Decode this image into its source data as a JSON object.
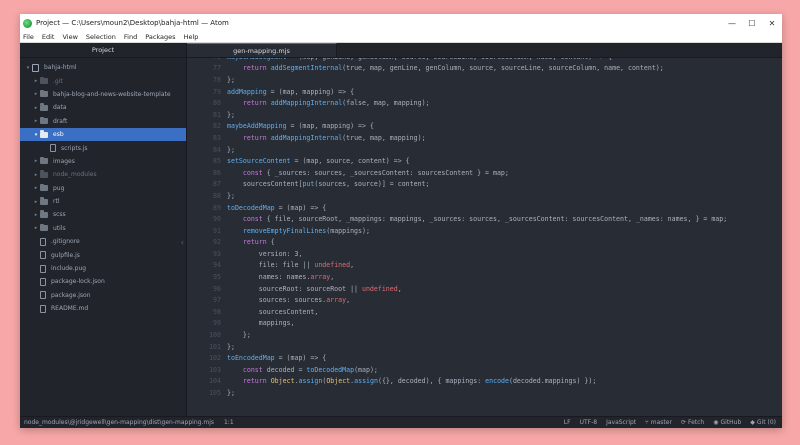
{
  "window": {
    "title": "Project — C:\\Users\\moun2\\Desktop\\bahja-html — Atom",
    "controls": {
      "minimize": "—",
      "maximize": "☐",
      "close": "✕"
    }
  },
  "menu": [
    "File",
    "Edit",
    "View",
    "Selection",
    "Find",
    "Packages",
    "Help"
  ],
  "sidebar": {
    "header": "Project",
    "items": [
      {
        "label": "bahja-html",
        "kind": "root",
        "expanded": true
      },
      {
        "label": ".git",
        "kind": "folder",
        "dim": true
      },
      {
        "label": "bahja-blog-and-news-website-template",
        "kind": "folder"
      },
      {
        "label": "data",
        "kind": "folder"
      },
      {
        "label": "draft",
        "kind": "folder"
      },
      {
        "label": "esb",
        "kind": "folder",
        "expanded": true,
        "selected": true
      },
      {
        "label": "scripts.js",
        "kind": "file",
        "indent": 2
      },
      {
        "label": "images",
        "kind": "folder"
      },
      {
        "label": "node_modules",
        "kind": "folder",
        "dim": true
      },
      {
        "label": "pug",
        "kind": "folder"
      },
      {
        "label": "rtl",
        "kind": "folder"
      },
      {
        "label": "scss",
        "kind": "folder"
      },
      {
        "label": "utils",
        "kind": "folder"
      },
      {
        "label": ".gitignore",
        "kind": "file"
      },
      {
        "label": "gulpfile.js",
        "kind": "file"
      },
      {
        "label": "include.pug",
        "kind": "file"
      },
      {
        "label": "package-lock.json",
        "kind": "file"
      },
      {
        "label": "package.json",
        "kind": "file"
      },
      {
        "label": "README.md",
        "kind": "file"
      }
    ]
  },
  "editor": {
    "tab": "gen-mapping.mjs",
    "lines": [
      {
        "n": "76",
        "code": "maybeAddSegment = (map, genLine, genColumn, source, sourceLine, sourceColumn, name, content) => {"
      },
      {
        "n": "77",
        "code": "    return addSegmentInternal(true, map, genLine, genColumn, source, sourceLine, sourceColumn, name, content);"
      },
      {
        "n": "78",
        "code": "};"
      },
      {
        "n": "79",
        "code": "addMapping = (map, mapping) => {"
      },
      {
        "n": "80",
        "code": "    return addMappingInternal(false, map, mapping);"
      },
      {
        "n": "81",
        "code": "};"
      },
      {
        "n": "82",
        "code": "maybeAddMapping = (map, mapping) => {"
      },
      {
        "n": "83",
        "code": "    return addMappingInternal(true, map, mapping);"
      },
      {
        "n": "84",
        "code": "};"
      },
      {
        "n": "85",
        "code": "setSourceContent = (map, source, content) => {"
      },
      {
        "n": "86",
        "code": "    const { _sources: sources, _sourcesContent: sourcesContent } = map;"
      },
      {
        "n": "87",
        "code": "    sourcesContent[put(sources, source)] = content;"
      },
      {
        "n": "88",
        "code": "};"
      },
      {
        "n": "89",
        "code": "toDecodedMap = (map) => {"
      },
      {
        "n": "90",
        "code": "    const { file, sourceRoot, _mappings: mappings, _sources: sources, _sourcesContent: sourcesContent, _names: names, } = map;"
      },
      {
        "n": "91",
        "code": "    removeEmptyFinalLines(mappings);"
      },
      {
        "n": "92",
        "code": "    return {"
      },
      {
        "n": "93",
        "code": "        version: 3,"
      },
      {
        "n": "94",
        "code": "        file: file || undefined,"
      },
      {
        "n": "95",
        "code": "        names: names.array,"
      },
      {
        "n": "96",
        "code": "        sourceRoot: sourceRoot || undefined,"
      },
      {
        "n": "97",
        "code": "        sources: sources.array,"
      },
      {
        "n": "98",
        "code": "        sourcesContent,"
      },
      {
        "n": "99",
        "code": "        mappings,"
      },
      {
        "n": "100",
        "code": "    };"
      },
      {
        "n": "101",
        "code": "};"
      },
      {
        "n": "102",
        "code": "toEncodedMap = (map) => {"
      },
      {
        "n": "103",
        "code": "    const decoded = toDecodedMap(map);"
      },
      {
        "n": "104",
        "code": "    return Object.assign(Object.assign({}, decoded), { mappings: encode(decoded.mappings) });"
      },
      {
        "n": "105",
        "code": "};"
      }
    ]
  },
  "statusbar": {
    "path": "node_modules\\@jridgewell\\gen-mapping\\dist\\gen-mapping.mjs",
    "cursor": "1:1",
    "line_ending": "LF",
    "encoding": "UTF-8",
    "grammar": "JavaScript",
    "branch": "master",
    "fetch": "Fetch",
    "github": "GitHub",
    "git": "Git (0)"
  }
}
